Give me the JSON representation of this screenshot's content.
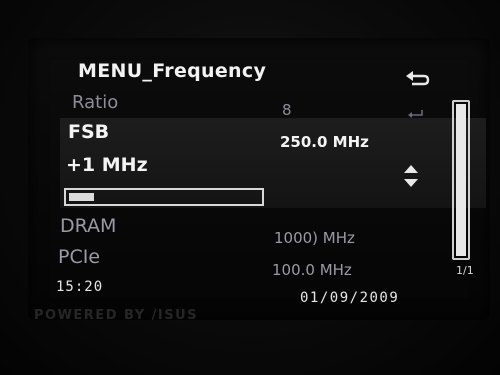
{
  "menu": {
    "title": "MENU_Frequency"
  },
  "items": {
    "ratio": {
      "label": "Ratio",
      "value": "8"
    },
    "fsb": {
      "label": "FSB",
      "value": "250.0 MHz",
      "step": "+1 MHz"
    },
    "dram": {
      "label": "DRAM",
      "value": "1000) MHz"
    },
    "pcie": {
      "label": "PCIe",
      "value": "100.0 MHz"
    }
  },
  "progress": {
    "fraction": 0.13
  },
  "scroll": {
    "page": "1/1"
  },
  "status": {
    "time": "15:20",
    "date": "01/09/2009"
  },
  "brand": {
    "text": "POWERED BY /ISUS"
  },
  "colors": {
    "text_active": "#f4f4f4",
    "text_inactive": "#9a9aa6",
    "highlight": "#1a1a1a",
    "background": "#070707"
  },
  "icons": [
    "return-arrow-icon",
    "enter-arrow-icon",
    "up-down-arrows-icon"
  ]
}
